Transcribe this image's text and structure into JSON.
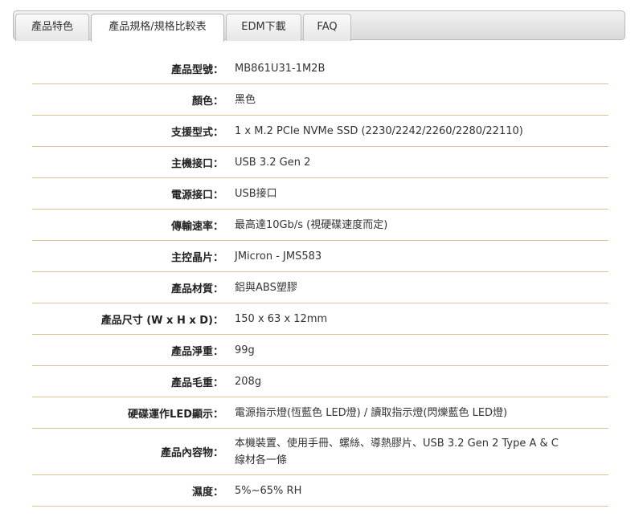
{
  "tabs": [
    {
      "label": "產品特色",
      "active": false
    },
    {
      "label": "產品規格/規格比較表",
      "active": true
    },
    {
      "label": "EDM下載",
      "active": false
    },
    {
      "label": "FAQ",
      "active": false
    }
  ],
  "specs": [
    {
      "label": "產品型號：",
      "value": "MB861U31-1M2B"
    },
    {
      "label": "顏色：",
      "value": "黑色"
    },
    {
      "label": "支援型式：",
      "value": "1 x M.2 PCIe NVMe SSD (2230/2242/2260/2280/22110)"
    },
    {
      "label": "主機接口：",
      "value": "USB 3.2 Gen 2"
    },
    {
      "label": "電源接口：",
      "value": "USB接口"
    },
    {
      "label": "傳輸速率：",
      "value": "最高達10Gb/s (視硬碟速度而定)"
    },
    {
      "label": "主控晶片：",
      "value": "JMicron - JMS583"
    },
    {
      "label": "產品材質：",
      "value": "鋁與ABS塑膠"
    },
    {
      "label": "產品尺寸 (W x H x D)：",
      "value": "150 x 63 x 12mm"
    },
    {
      "label": "產品淨重：",
      "value": "99g"
    },
    {
      "label": "產品毛重：",
      "value": "208g"
    },
    {
      "label": "硬碟運作LED顯示：",
      "value": "電源指示燈(恆藍色 LED燈) / 讀取指示燈(閃爍藍色 LED燈)"
    },
    {
      "label": "產品內容物：",
      "value": "本機裝置、使用手冊、螺絲、導熱膠片、USB 3.2 Gen 2 Type A & C線材各一條"
    },
    {
      "label": "濕度：",
      "value": "5%~65% RH"
    }
  ]
}
